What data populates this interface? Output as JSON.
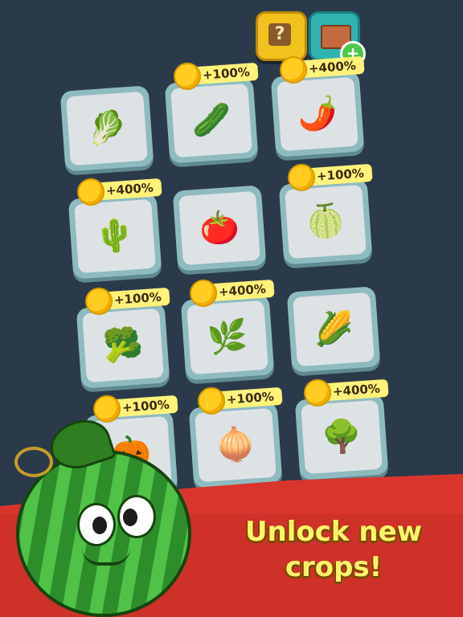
{
  "top_buttons": {
    "help": {
      "icon": "question-icon",
      "glyph": "?"
    },
    "shop": {
      "icon": "crate-icon",
      "badge_glyph": "+"
    }
  },
  "cards": [
    {
      "crop": "cabbage",
      "art": "🥬",
      "bonus": ""
    },
    {
      "crop": "cucumber",
      "art": "🥒",
      "bonus": "+100%"
    },
    {
      "crop": "chili",
      "art": "🌶️",
      "bonus": "+400%"
    },
    {
      "crop": "cactus",
      "art": "🌵",
      "bonus": "+400%"
    },
    {
      "crop": "tomato",
      "art": "🍅",
      "bonus": ""
    },
    {
      "crop": "watermelon",
      "art": "🍈",
      "bonus": "+100%"
    },
    {
      "crop": "broccoli",
      "art": "🥦",
      "bonus": "+100%"
    },
    {
      "crop": "flytrap",
      "art": "🌿",
      "bonus": "+400%"
    },
    {
      "crop": "corn",
      "art": "🌽",
      "bonus": ""
    },
    {
      "crop": "pumpkin",
      "art": "🎃",
      "bonus": "+100%"
    },
    {
      "crop": "onion",
      "art": "🧅",
      "bonus": "+100%"
    },
    {
      "crop": "bonsai",
      "art": "🌳",
      "bonus": "+400%"
    }
  ],
  "tagline": {
    "line1": "Unlock new",
    "line2": "crops!"
  },
  "colors": {
    "background": "#2b3a4a",
    "card_frame": "#8ebbc0",
    "bonus_label": "#fff27a",
    "ground": "#d9352c",
    "tagline": "#fff36b"
  }
}
